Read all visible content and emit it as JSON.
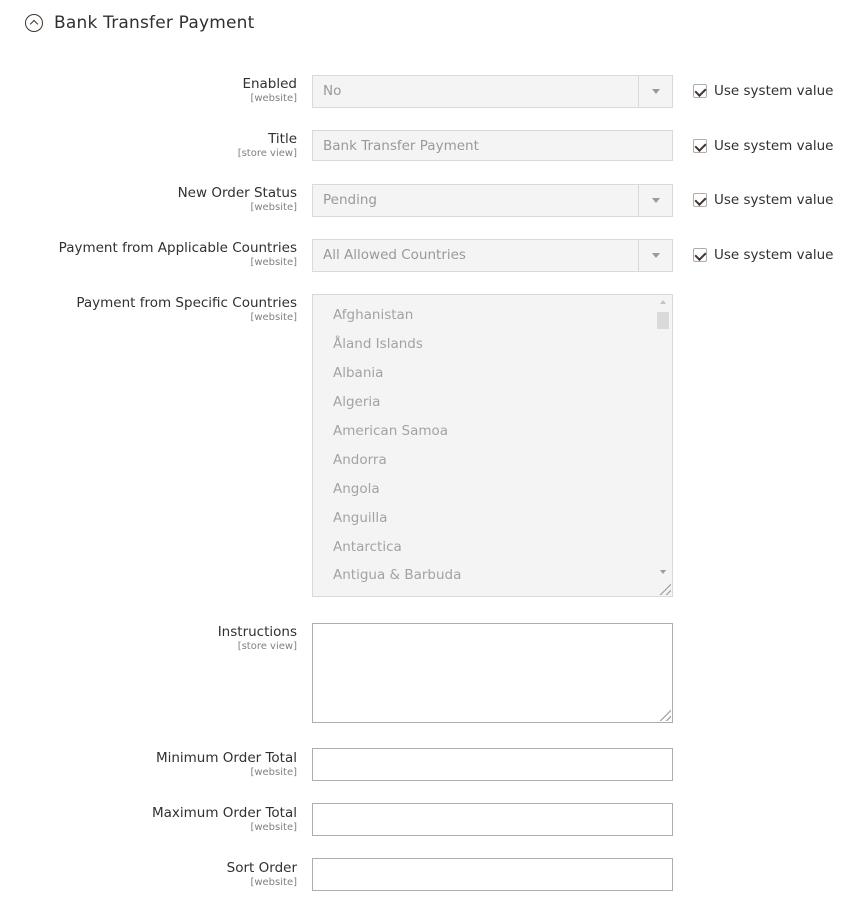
{
  "section": {
    "title": "Bank Transfer Payment",
    "icon": "collapse-circle-up-icon",
    "expanded": true
  },
  "fields": {
    "enabled": {
      "label": "Enabled",
      "scope": "[website]",
      "value": "No",
      "disabled": true,
      "use_system_value": true
    },
    "title": {
      "label": "Title",
      "scope": "[store view]",
      "value": "Bank Transfer Payment",
      "disabled": true,
      "use_system_value": true
    },
    "new_order_status": {
      "label": "New Order Status",
      "scope": "[website]",
      "value": "Pending",
      "disabled": true,
      "use_system_value": true
    },
    "applicable_countries": {
      "label": "Payment from Applicable Countries",
      "scope": "[website]",
      "value": "All Allowed Countries",
      "disabled": true,
      "use_system_value": true
    },
    "specific_countries": {
      "label": "Payment from Specific Countries",
      "scope": "[website]",
      "disabled": true,
      "options": [
        "Afghanistan",
        "Åland Islands",
        "Albania",
        "Algeria",
        "American Samoa",
        "Andorra",
        "Angola",
        "Anguilla",
        "Antarctica",
        "Antigua & Barbuda"
      ]
    },
    "instructions": {
      "label": "Instructions",
      "scope": "[store view]",
      "value": ""
    },
    "min_order_total": {
      "label": "Minimum Order Total",
      "scope": "[website]",
      "value": ""
    },
    "max_order_total": {
      "label": "Maximum Order Total",
      "scope": "[website]",
      "value": ""
    },
    "sort_order": {
      "label": "Sort Order",
      "scope": "[website]",
      "value": ""
    }
  },
  "use_system_value_label": "Use system value"
}
